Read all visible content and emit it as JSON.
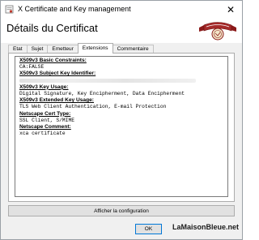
{
  "window": {
    "title": "X Certificate and Key management",
    "close_glyph": "✕"
  },
  "dialog": {
    "title": "Détails du Certificat"
  },
  "tabs": [
    {
      "label": "Etat",
      "active": false
    },
    {
      "label": "Sujet",
      "active": false
    },
    {
      "label": "Emetteur",
      "active": false
    },
    {
      "label": "Extensions",
      "active": true
    },
    {
      "label": "Commentaire",
      "active": false
    }
  ],
  "extensions": {
    "basic_constraints_heading": "X509v3 Basic Constraints:",
    "basic_constraints_value": "CA:FALSE",
    "subject_key_id_heading": "X509v3 Subject Key Identifier:",
    "key_usage_heading": "X509v3 Key Usage:",
    "key_usage_value": "Digital Signature, Key Encipherment, Data Encipherment",
    "ext_key_usage_heading": "X509v3 Extended Key Usage:",
    "ext_key_usage_value": "TLS Web Client Authentication, E-mail Protection",
    "netscape_cert_type_heading": "Netscape Cert Type:",
    "netscape_cert_type_value": "SSL Client, S/MIME",
    "netscape_comment_heading": "Netscape Comment:",
    "netscape_comment_value": "xca certificate"
  },
  "buttons": {
    "show_config": "Afficher la configuration",
    "ok": "OK"
  },
  "watermark": {
    "text_main": "LaMaisonBleue",
    "text_suffix": ".net"
  },
  "icons": {
    "app": "certificate-app-icon",
    "close": "close-icon",
    "logo": "ribbon-seal-logo"
  }
}
